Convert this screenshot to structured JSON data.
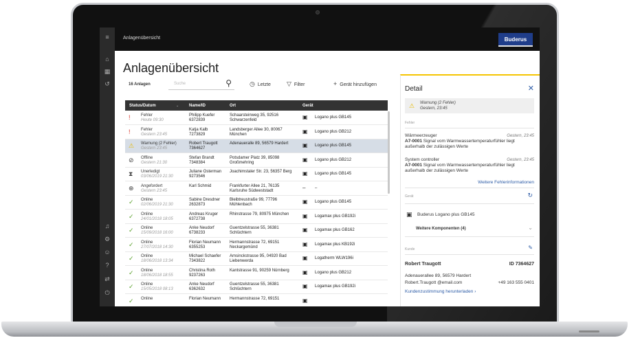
{
  "app": {
    "window_title": "Anlagenübersicht",
    "brand": "Buderus",
    "page_title": "Anlagenübersicht"
  },
  "sidebar": {
    "icons": [
      "menu-icon",
      "home-icon",
      "buildings-icon",
      "history-icon",
      "bell-icon",
      "settings-icon",
      "profile-icon",
      "help-icon",
      "transfer-icon",
      "logout-icon"
    ]
  },
  "toolbar": {
    "count": "16 Anlagen",
    "search_placeholder": "Suche",
    "recent": "Letzte",
    "filter": "Filter",
    "add": "Gerät hinzufügen"
  },
  "table": {
    "headers": [
      "Status/Datum",
      "Name/ID",
      "Ort",
      "Gerät"
    ],
    "rows": [
      {
        "status": "Fehler",
        "date": "Heute 09:30",
        "name": "Philipp Kuefer",
        "id": "6372839",
        "addr1": "Schaarsteinweg 35, 92516",
        "addr2": "Schwarzenfeld",
        "device": "Logano plus GB145",
        "icon": "error-icon",
        "color": "#d9352b",
        "glyph": "!"
      },
      {
        "status": "Fehler",
        "date": "Gestern 23:45",
        "name": "Katja Kalb",
        "id": "7273829",
        "addr1": "Landsberger Allee 30, 80067",
        "addr2": "München",
        "device": "Logano plus GB212",
        "icon": "error-icon",
        "color": "#d9352b",
        "glyph": "!"
      },
      {
        "status": "Warnung (2 Fehler)",
        "date": "Gestern 23:45",
        "name": "Robert Traugott",
        "id": "7364627",
        "addr1": "Adenaueralle 89, 56579 Hardert",
        "addr2": "",
        "device": "Logano plus GB145",
        "icon": "warning-icon",
        "color": "#e6b800",
        "glyph": "⚠",
        "selected": true
      },
      {
        "status": "Offline",
        "date": "Gestern 21:30",
        "name": "Stefan Brandt",
        "id": "7348384",
        "addr1": "Potsdamer Platz 39, 85098",
        "addr2": "Großmehring",
        "device": "Logano plus GB212",
        "icon": "offline-icon",
        "color": "#444444",
        "glyph": "⊘"
      },
      {
        "status": "Unerledigt",
        "date": "03/06/2019 21:30",
        "name": "Juliane Osterman",
        "id": "9273546",
        "addr1": "Joachimstaler Str. 23, 56357 Berg",
        "addr2": "",
        "device": "Logano plus GB145",
        "icon": "hourglass-icon",
        "color": "#444444",
        "glyph": "⧗"
      },
      {
        "status": "Angefordert",
        "date": "Gestern 23:45",
        "name": "Karl Schmid",
        "id": "",
        "addr1": "Frankfurter Allee 21, 76135",
        "addr2": "Karlsruhe Südweststadt",
        "device": "–",
        "icon": "plus-circle-icon",
        "color": "#444444",
        "glyph": "⊕"
      },
      {
        "status": "Online",
        "date": "02/06/2019 21:30",
        "name": "Sabine Dresdner",
        "id": "2632873",
        "addr1": "Bleibtreustraße 99, 77796",
        "addr2": "Mühlenbach",
        "device": "Logano plus GB145",
        "icon": "check-circle-icon",
        "color": "#5aa02c",
        "glyph": "✓"
      },
      {
        "status": "Online",
        "date": "24/01/2018 18:05",
        "name": "Andreas Kruger",
        "id": "6372738",
        "addr1": "Rhinstrasse 79, 80975 München",
        "addr2": "",
        "device": "Logamax plus GB192i",
        "icon": "check-circle-icon",
        "color": "#5aa02c",
        "glyph": "✓"
      },
      {
        "status": "Online",
        "date": "15/09/2018 16:00",
        "name": "Anke Neudorf",
        "id": "6738233",
        "addr1": "Guentzelstrasse 55, 36381",
        "addr2": "Schlüchtern",
        "device": "Logamax plus GB162",
        "icon": "check-circle-icon",
        "color": "#5aa02c",
        "glyph": "✓"
      },
      {
        "status": "Online",
        "date": "27/07/2018 14:30",
        "name": "Florian Neumann",
        "id": "6355253",
        "addr1": "Hermannstrasse 72, 69151",
        "addr2": "Neckargemünd",
        "device": "Logamax plus KB192i",
        "icon": "check-circle-icon",
        "color": "#5aa02c",
        "glyph": "✓"
      },
      {
        "status": "Online",
        "date": "18/06/2018 13:34",
        "name": "Michael Schaefer",
        "id": "7343822",
        "addr1": "Amsinckstrasse 95, 04920 Bad",
        "addr2": "Liebenwerda",
        "device": "Logatherm WLW196i",
        "icon": "check-circle-icon",
        "color": "#5aa02c",
        "glyph": "✓"
      },
      {
        "status": "Online",
        "date": "18/06/2018 18:55",
        "name": "Christina Roth",
        "id": "9237263",
        "addr1": "Kantstrasse 91, 90259 Nürnberg",
        "addr2": "",
        "device": "Logano plus GB212",
        "icon": "check-circle-icon",
        "color": "#5aa02c",
        "glyph": "✓"
      },
      {
        "status": "Online",
        "date": "15/05/2018 08:13",
        "name": "Anke Neudorf",
        "id": "6362632",
        "addr1": "Guentzelstrasse 55, 36381",
        "addr2": "Schlüchtern",
        "device": "Logamax plus GB192i",
        "icon": "check-circle-icon",
        "color": "#5aa02c",
        "glyph": "✓"
      },
      {
        "status": "Online",
        "date": "",
        "name": "Florian Neumann",
        "id": "",
        "addr1": "Hermannstrasse 72, 69151",
        "addr2": "",
        "device": "",
        "icon": "check-circle-icon",
        "color": "#5aa02c",
        "glyph": "✓"
      }
    ]
  },
  "detail": {
    "title": "Detail",
    "warning_line1": "Warnung (2 Fehler)",
    "warning_line2": "Gestern, 23:45",
    "section_errors": "Fehler",
    "err1_source": "Wärmeerzeuger",
    "err1_time": "Gestern, 23:45",
    "err1_code": "A7-0001",
    "err1_text": " Signal vom Warmwassertemperaturfühler liegt außerhalb der zulässigen Werte",
    "err2_source": "System controller",
    "err2_time": "Gestern, 23:45",
    "err2_code": "A7-0001",
    "err2_text": " Signal vom Warmwassertemperaturfühler liegt außerhalb der zulässigen Werte",
    "more_errors": "Weitere Fehlerinformationen",
    "section_device": "Gerät",
    "device_name": "Buderus Logano plus GB145",
    "more_components": "Weitere Komponenten (4)",
    "section_customer": "Kunde",
    "customer_name": "Robert Traugott",
    "customer_id": "ID 7364627",
    "customer_address": "Adenauerallee 89, 56579 Hardert",
    "customer_email": "Robert.Traugott @email.com",
    "customer_phone": "+49 163 555 0401",
    "download_consent": "Kundenzustimmung herunterladen"
  }
}
